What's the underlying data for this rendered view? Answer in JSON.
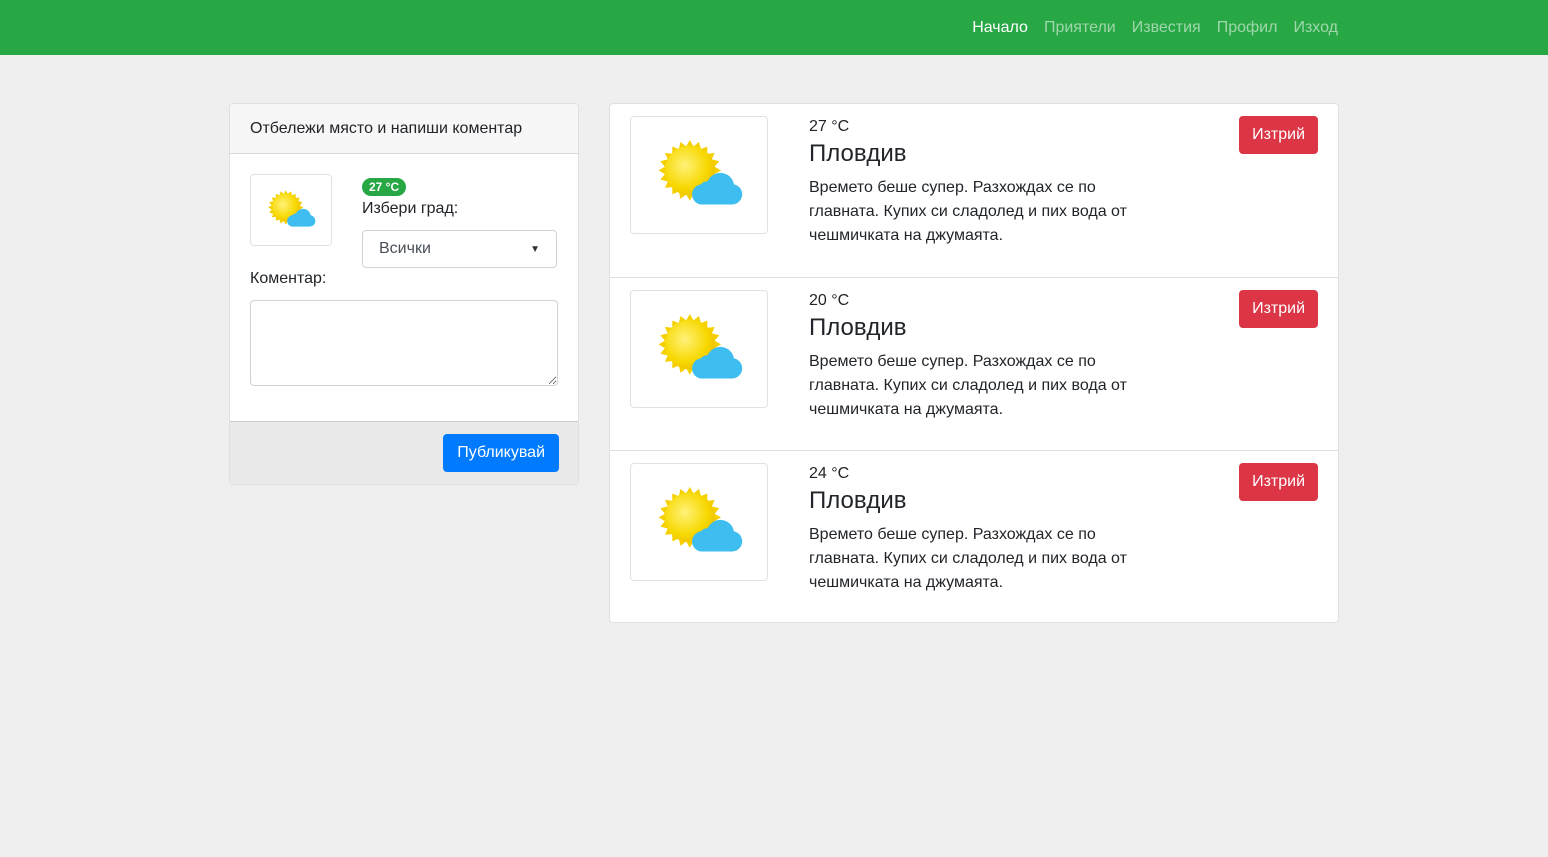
{
  "navbar": {
    "links": [
      {
        "label": "Начало",
        "active": true
      },
      {
        "label": "Приятели",
        "active": false
      },
      {
        "label": "Известия",
        "active": false
      },
      {
        "label": "Профил",
        "active": false
      },
      {
        "label": "Изход",
        "active": false
      }
    ]
  },
  "compose": {
    "header": "Отбележи място и напиши коментар",
    "weather_icon": "sun-cloud-icon",
    "temp_badge": "27 °C",
    "city_label": "Избери град:",
    "city_select_value": "Всички",
    "comment_label": "Коментар:",
    "comment_value": "",
    "publish_label": "Публикувай"
  },
  "posts": [
    {
      "temp": "27 °C",
      "city": "Пловдив",
      "text": "Времето беше супер. Разхождах се по главната. Купих си сладолед и пих вода от чешмичката на джумаята.",
      "delete_label": "Изтрий",
      "weather_icon": "sun-cloud-icon"
    },
    {
      "temp": "20 °C",
      "city": "Пловдив",
      "text": "Времето беше супер. Разхождах се по главната. Купих си сладолед и пих вода от чешмичката на джумаята.",
      "delete_label": "Изтрий",
      "weather_icon": "sun-cloud-icon"
    },
    {
      "temp": "24 °C",
      "city": "Пловдив",
      "text": "Времето беше супер. Разхождах се по главната. Купих си сладолед и пих вода от чешмичката на джумаята.",
      "delete_label": "Изтрий",
      "weather_icon": "sun-cloud-icon"
    }
  ],
  "colors": {
    "navbar": "#28a745",
    "primary": "#007bff",
    "danger": "#dc3545",
    "sun": "#f5d000",
    "cloud": "#3dbdf0"
  }
}
